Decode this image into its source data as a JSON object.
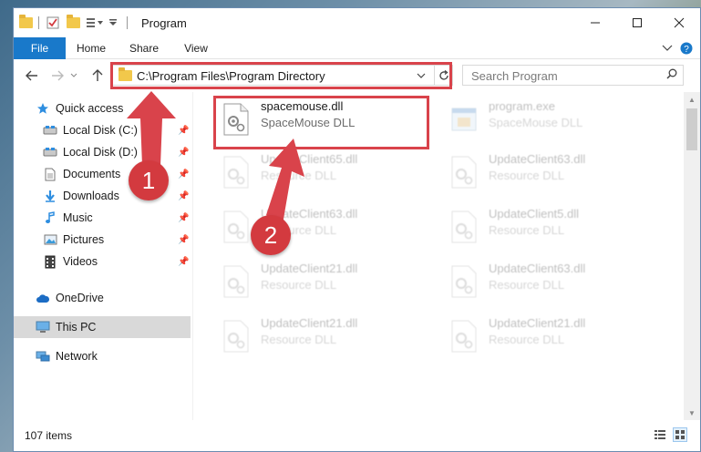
{
  "window": {
    "title": "Program",
    "minimize_icon": "minimize-icon",
    "maximize_icon": "maximize-icon",
    "close_icon": "close-icon"
  },
  "ribbon": {
    "tabs": [
      {
        "label": "File"
      },
      {
        "label": "Home"
      },
      {
        "label": "Share"
      },
      {
        "label": "View"
      }
    ],
    "accent": "#1979ca"
  },
  "address_bar": {
    "path": "C:\\Program Files\\Program Directory"
  },
  "search": {
    "placeholder": "Search Program"
  },
  "sidebar": {
    "items": [
      {
        "label": "Quick access",
        "icon": "star-icon"
      },
      {
        "label": "Local Disk (C:)",
        "icon": "drive-icon"
      },
      {
        "label": "Local Disk (D:)",
        "icon": "drive-icon"
      },
      {
        "label": "Documents",
        "icon": "documents-icon"
      },
      {
        "label": "Downloads",
        "icon": "download-icon"
      },
      {
        "label": "Music",
        "icon": "music-icon"
      },
      {
        "label": "Pictures",
        "icon": "pictures-icon"
      },
      {
        "label": "Videos",
        "icon": "videos-icon"
      },
      {
        "label": "OneDrive",
        "icon": "cloud-icon"
      },
      {
        "label": "This PC",
        "icon": "computer-icon"
      },
      {
        "label": "Network",
        "icon": "network-icon"
      }
    ],
    "selected": "This PC"
  },
  "files": [
    {
      "name": "spacemouse.dll",
      "type": "SpaceMouse DLL"
    },
    {
      "name": "program.exe",
      "type": "SpaceMouse DLL"
    },
    {
      "name": "UpdateClient65.dll",
      "type": "Resource DLL"
    },
    {
      "name": "UpdateClient63.dll",
      "type": "Resource DLL"
    },
    {
      "name": "UpdateClient63.dll",
      "type": "Resource DLL"
    },
    {
      "name": "UpdateClient5.dll",
      "type": "Resource DLL"
    },
    {
      "name": "UpdateClient21.dll",
      "type": "Resource DLL"
    },
    {
      "name": "UpdateClient63.dll",
      "type": "Resource DLL"
    },
    {
      "name": "UpdateClient21.dll",
      "type": "Resource DLL"
    },
    {
      "name": "UpdateClient21.dll",
      "type": "Resource DLL"
    }
  ],
  "status": {
    "item_count": "107 items"
  },
  "annotations": {
    "step1": "1",
    "step2": "2",
    "color": "#d9434b"
  }
}
